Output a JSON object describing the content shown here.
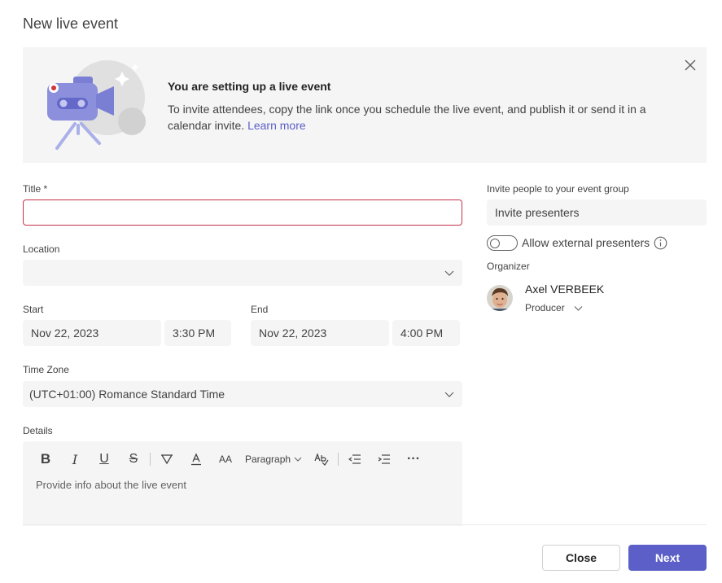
{
  "dialog": {
    "title": "New live event"
  },
  "banner": {
    "heading": "You are setting up a live event",
    "body": "To invite attendees, copy the link once you schedule the live event, and publish it or send it in a calendar invite.",
    "link": "Learn more"
  },
  "form": {
    "title_label": "Title *",
    "title_value": "",
    "location_label": "Location",
    "location_value": "",
    "start_label": "Start",
    "start_date": "Nov 22, 2023",
    "start_time": "3:30 PM",
    "end_label": "End",
    "end_date": "Nov 22, 2023",
    "end_time": "4:00 PM",
    "timezone_label": "Time Zone",
    "timezone_value": "(UTC+01:00) Romance Standard Time",
    "details_label": "Details",
    "details_placeholder": "Provide info about the live event"
  },
  "toolbar": {
    "bold": "B",
    "italic": "I",
    "underline": "U",
    "strike": "S",
    "font_size": "AA",
    "paragraph": "Paragraph",
    "more": "···"
  },
  "invite": {
    "label": "Invite people to your event group",
    "placeholder": "Invite presenters",
    "allow_external": "Allow external presenters",
    "organizer_label": "Organizer",
    "organizer_name": "Axel VERBEEK",
    "organizer_role": "Producer"
  },
  "buttons": {
    "close": "Close",
    "next": "Next"
  },
  "colors": {
    "accent": "#5b5fc7",
    "error_border": "#c4314b",
    "field_bg": "#f5f5f5"
  }
}
